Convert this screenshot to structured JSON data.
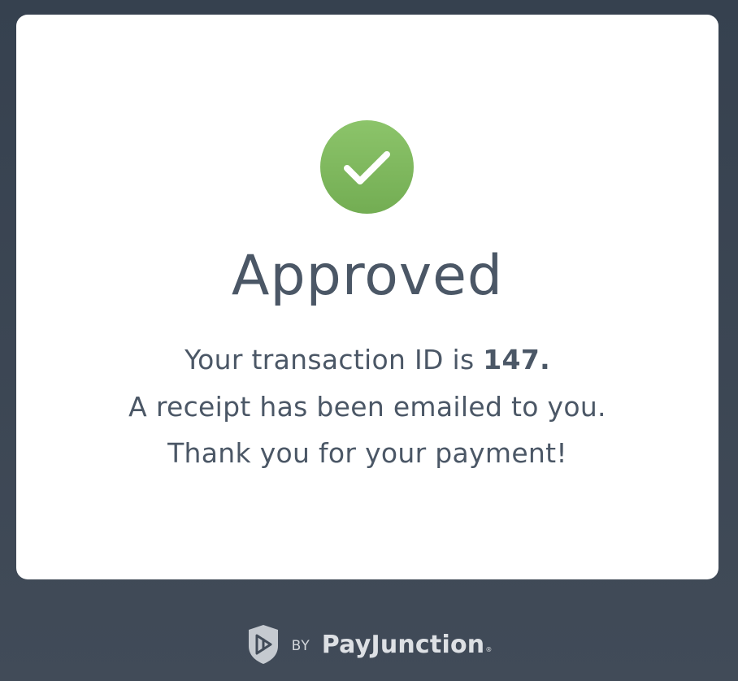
{
  "colors": {
    "background": "#3b4552",
    "card": "#ffffff",
    "success_green": "#7ab75b",
    "text": "#4b5766",
    "footer_text": "#d3d7dc"
  },
  "status": {
    "icon": "check-icon",
    "title": "Approved"
  },
  "message": {
    "line1_prefix": "Your transaction ID is ",
    "transaction_id": "147.",
    "line2": "A receipt has been emailed to you.",
    "line3": "Thank you for your payment!"
  },
  "footer": {
    "logo_icon": "payjunction-shield-icon",
    "by": "BY",
    "brand": "PayJunction",
    "registered": "®"
  }
}
